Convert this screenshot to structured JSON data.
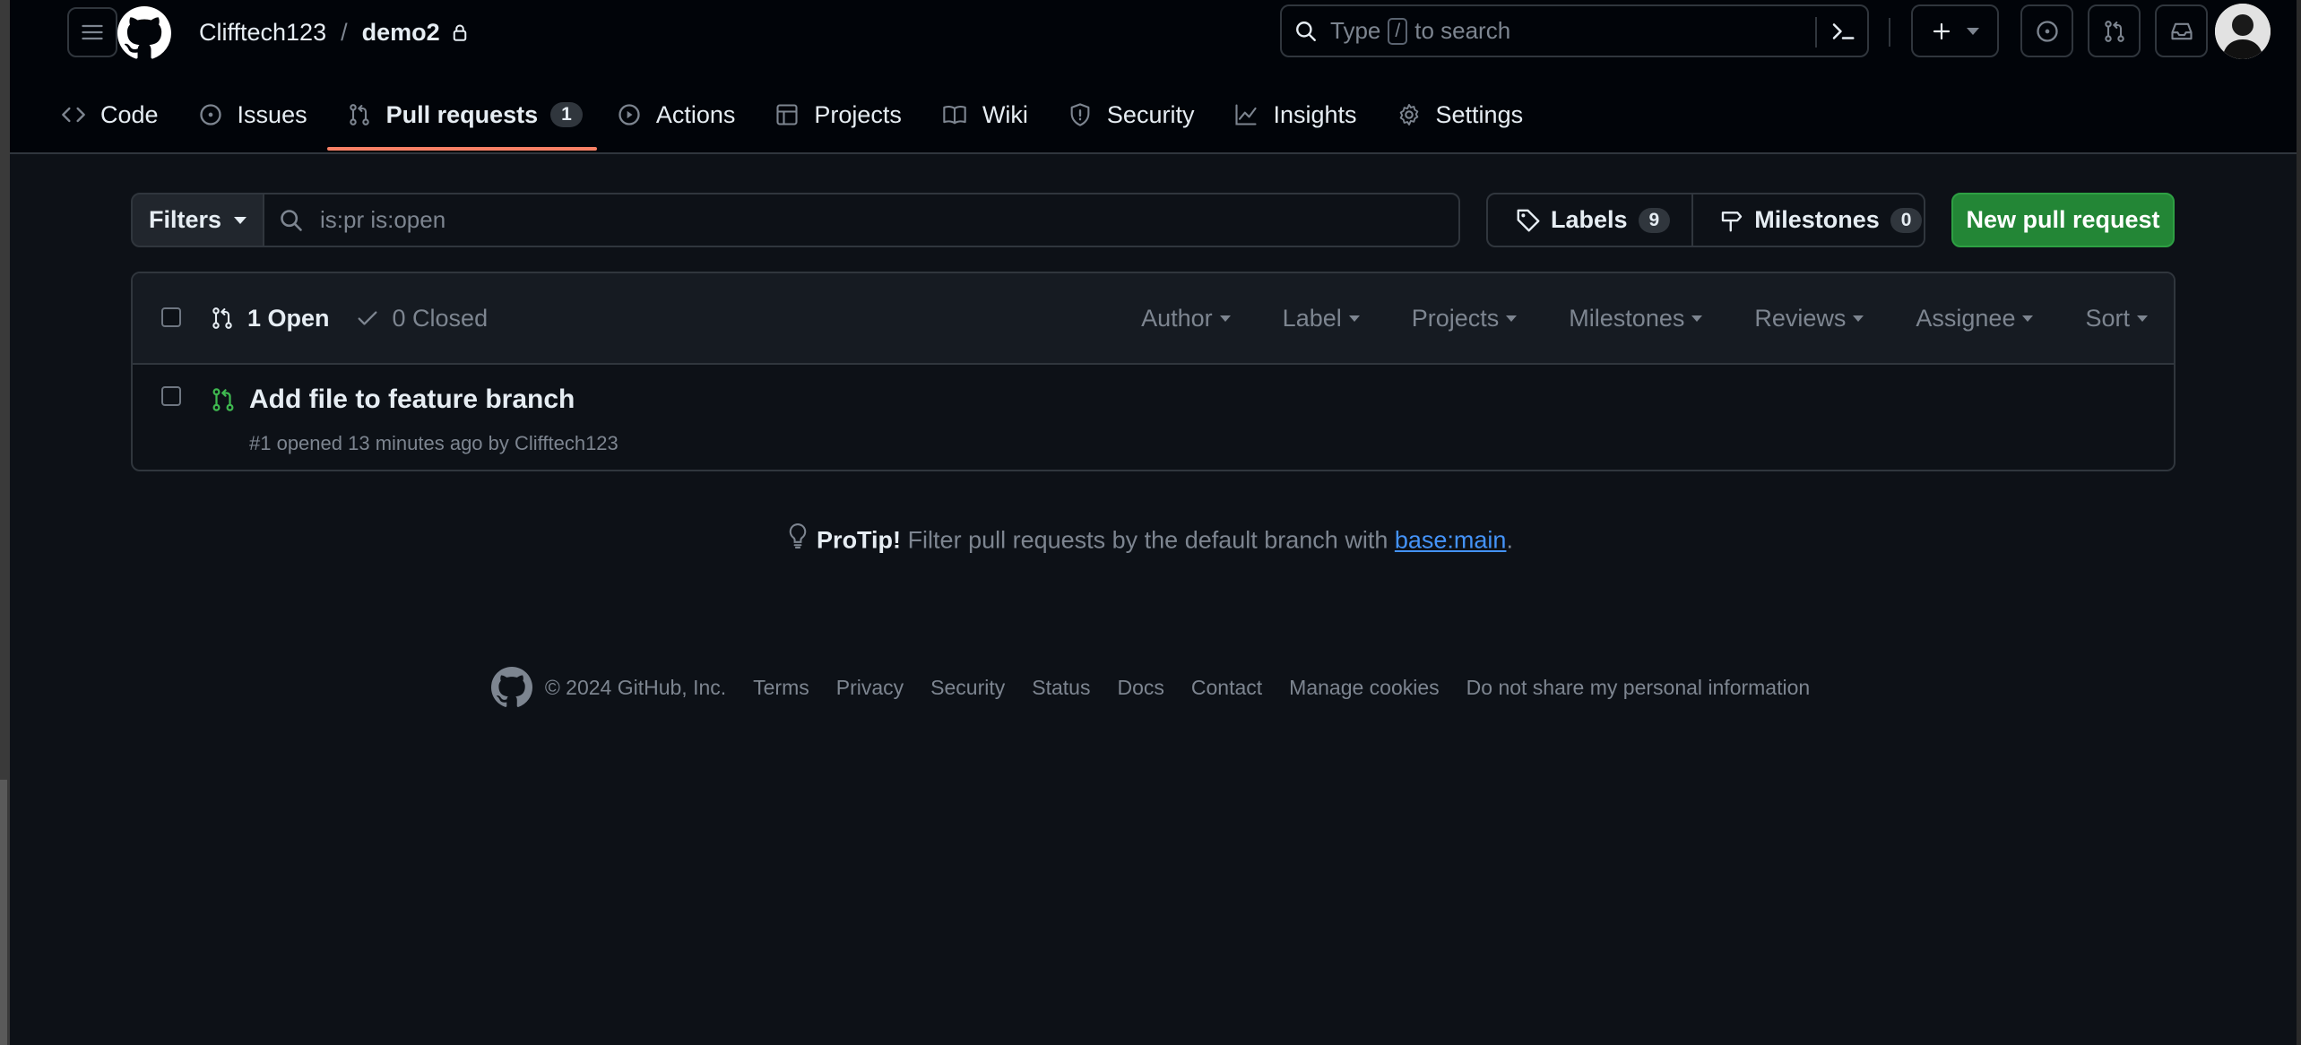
{
  "header": {
    "owner": "Clifftech123",
    "separator": "/",
    "repo": "demo2",
    "search": {
      "prefix": "Type",
      "key": "/",
      "suffix": "to search"
    }
  },
  "tabs": [
    {
      "label": "Code",
      "icon": "code-icon"
    },
    {
      "label": "Issues",
      "icon": "issue-opened-icon"
    },
    {
      "label": "Pull requests",
      "icon": "git-pull-request-icon",
      "count": "1",
      "active": true
    },
    {
      "label": "Actions",
      "icon": "play-icon"
    },
    {
      "label": "Projects",
      "icon": "table-icon"
    },
    {
      "label": "Wiki",
      "icon": "book-icon"
    },
    {
      "label": "Security",
      "icon": "shield-icon"
    },
    {
      "label": "Insights",
      "icon": "graph-icon"
    },
    {
      "label": "Settings",
      "icon": "gear-icon"
    }
  ],
  "toolbar": {
    "filters_label": "Filters",
    "query_value": "is:pr is:open",
    "labels_label": "Labels",
    "labels_count": "9",
    "milestones_label": "Milestones",
    "milestones_count": "0",
    "new_pr_label": "New pull request"
  },
  "list": {
    "open_label": "1 Open",
    "closed_label": "0 Closed",
    "sort_filters": [
      "Author",
      "Label",
      "Projects",
      "Milestones",
      "Reviews",
      "Assignee",
      "Sort"
    ],
    "items": [
      {
        "title": "Add file to feature branch",
        "meta": "#1 opened 13 minutes ago by Clifftech123"
      }
    ]
  },
  "protip": {
    "label": "ProTip!",
    "text": "Filter pull requests by the default branch with",
    "link": "base:main",
    "end": "."
  },
  "footer": {
    "copyright": "© 2024 GitHub, Inc.",
    "links": [
      "Terms",
      "Privacy",
      "Security",
      "Status",
      "Docs",
      "Contact",
      "Manage cookies",
      "Do not share my personal information"
    ]
  },
  "colors": {
    "background": "#0d1117",
    "header_bg": "#010409",
    "active_underline": "#f78166",
    "new_pr_button": "#238636",
    "open_pr_icon": "#3fb950",
    "link": "#4493f8"
  }
}
